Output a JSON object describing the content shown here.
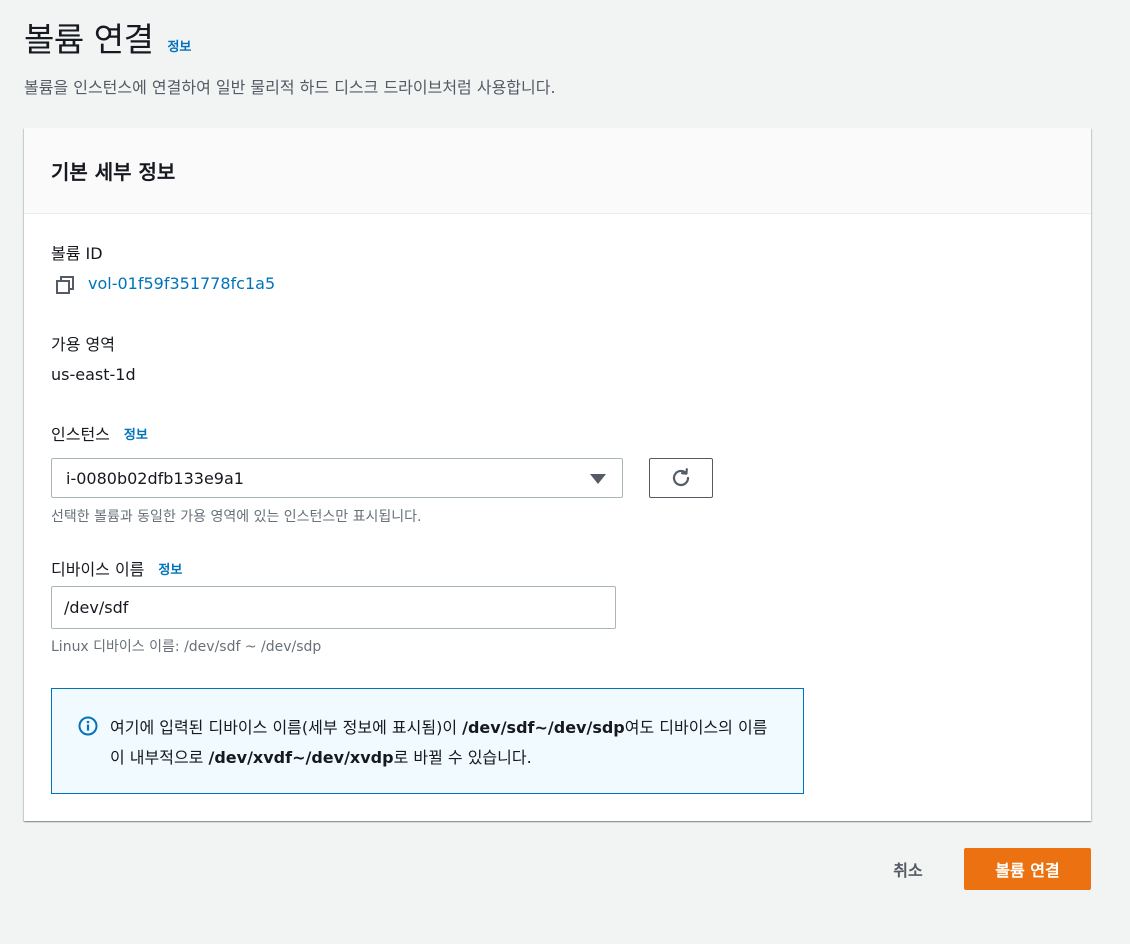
{
  "header": {
    "title": "볼륨 연결",
    "info_label": "정보",
    "description": "볼륨을 인스턴스에 연결하여 일반 물리적 하드 디스크 드라이브처럼 사용합니다."
  },
  "panel": {
    "title": "기본 세부 정보",
    "volume": {
      "label": "볼륨 ID",
      "copy_icon": "copy-icon",
      "value": "vol-01f59f351778fc1a5"
    },
    "availability_zone": {
      "label": "가용 영역",
      "value": "us-east-1d"
    },
    "instance": {
      "label": "인스턴스",
      "info_label": "정보",
      "selected": "i-0080b02dfb133e9a1",
      "hint": "선택한 볼륨과 동일한 가용 영역에 있는 인스턴스만 표시됩니다.",
      "refresh_icon": "refresh-icon"
    },
    "device": {
      "label": "디바이스 이름",
      "info_label": "정보",
      "value": "/dev/sdf",
      "hint": "Linux 디바이스 이름: /dev/sdf ~ /dev/sdp"
    },
    "alert": {
      "icon": "info-circle-icon",
      "text_1": "여기에 입력된 디바이스 이름(세부 정보에 표시됨)이 ",
      "bold_1": "/dev/sdf~/dev/sdp",
      "text_2": "여도 디바이스의 이름이 내부적으로 ",
      "bold_2": "/dev/xvdf~/dev/xvdp",
      "text_3": "로 바뀔 수 있습니다."
    }
  },
  "footer": {
    "cancel_label": "취소",
    "submit_label": "볼륨 연결"
  },
  "colors": {
    "link": "#0073bb",
    "primary_button": "#ec7211",
    "alert_border": "#0073bb",
    "alert_background": "#f1faff"
  }
}
